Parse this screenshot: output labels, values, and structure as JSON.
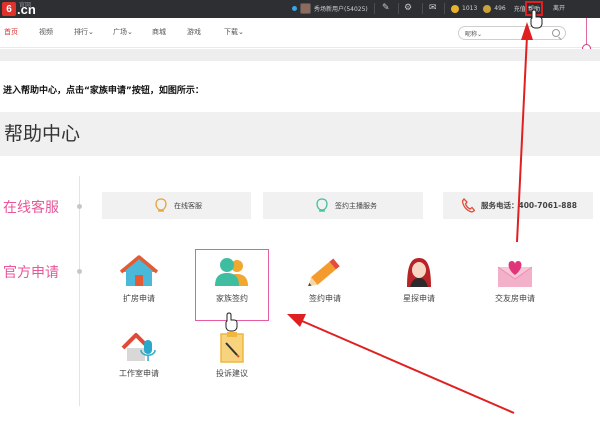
{
  "topbar": {
    "logo_text": ".cn",
    "logo_small": "官网",
    "user": "秀场新用户(54025)",
    "coin1": "1013",
    "coin2": "496",
    "recharge": "充值",
    "help": "帮助",
    "exit": "离开"
  },
  "nav": {
    "items": [
      "首页",
      "视频",
      "排行",
      "广场",
      "商城",
      "游戏",
      "下载"
    ],
    "search_label": "昵称"
  },
  "intro": "进入帮助中心，点击“家族申请”按钮，如图所示：",
  "help_center": {
    "title": "帮助中心",
    "online_label": "在线客服",
    "official_label": "官方申请",
    "services": [
      "在线客服",
      "签约主播服务",
      "服务电话：400-7061-888"
    ],
    "apps": [
      "扩房申请",
      "家族签约",
      "签约申请",
      "星探申请",
      "交友房申请",
      "工作室申请",
      "投诉建议"
    ]
  },
  "colors": {
    "accent_pink": "#e9569a",
    "annotation_red": "#e02020",
    "topbar_bg": "#2e2f33"
  }
}
